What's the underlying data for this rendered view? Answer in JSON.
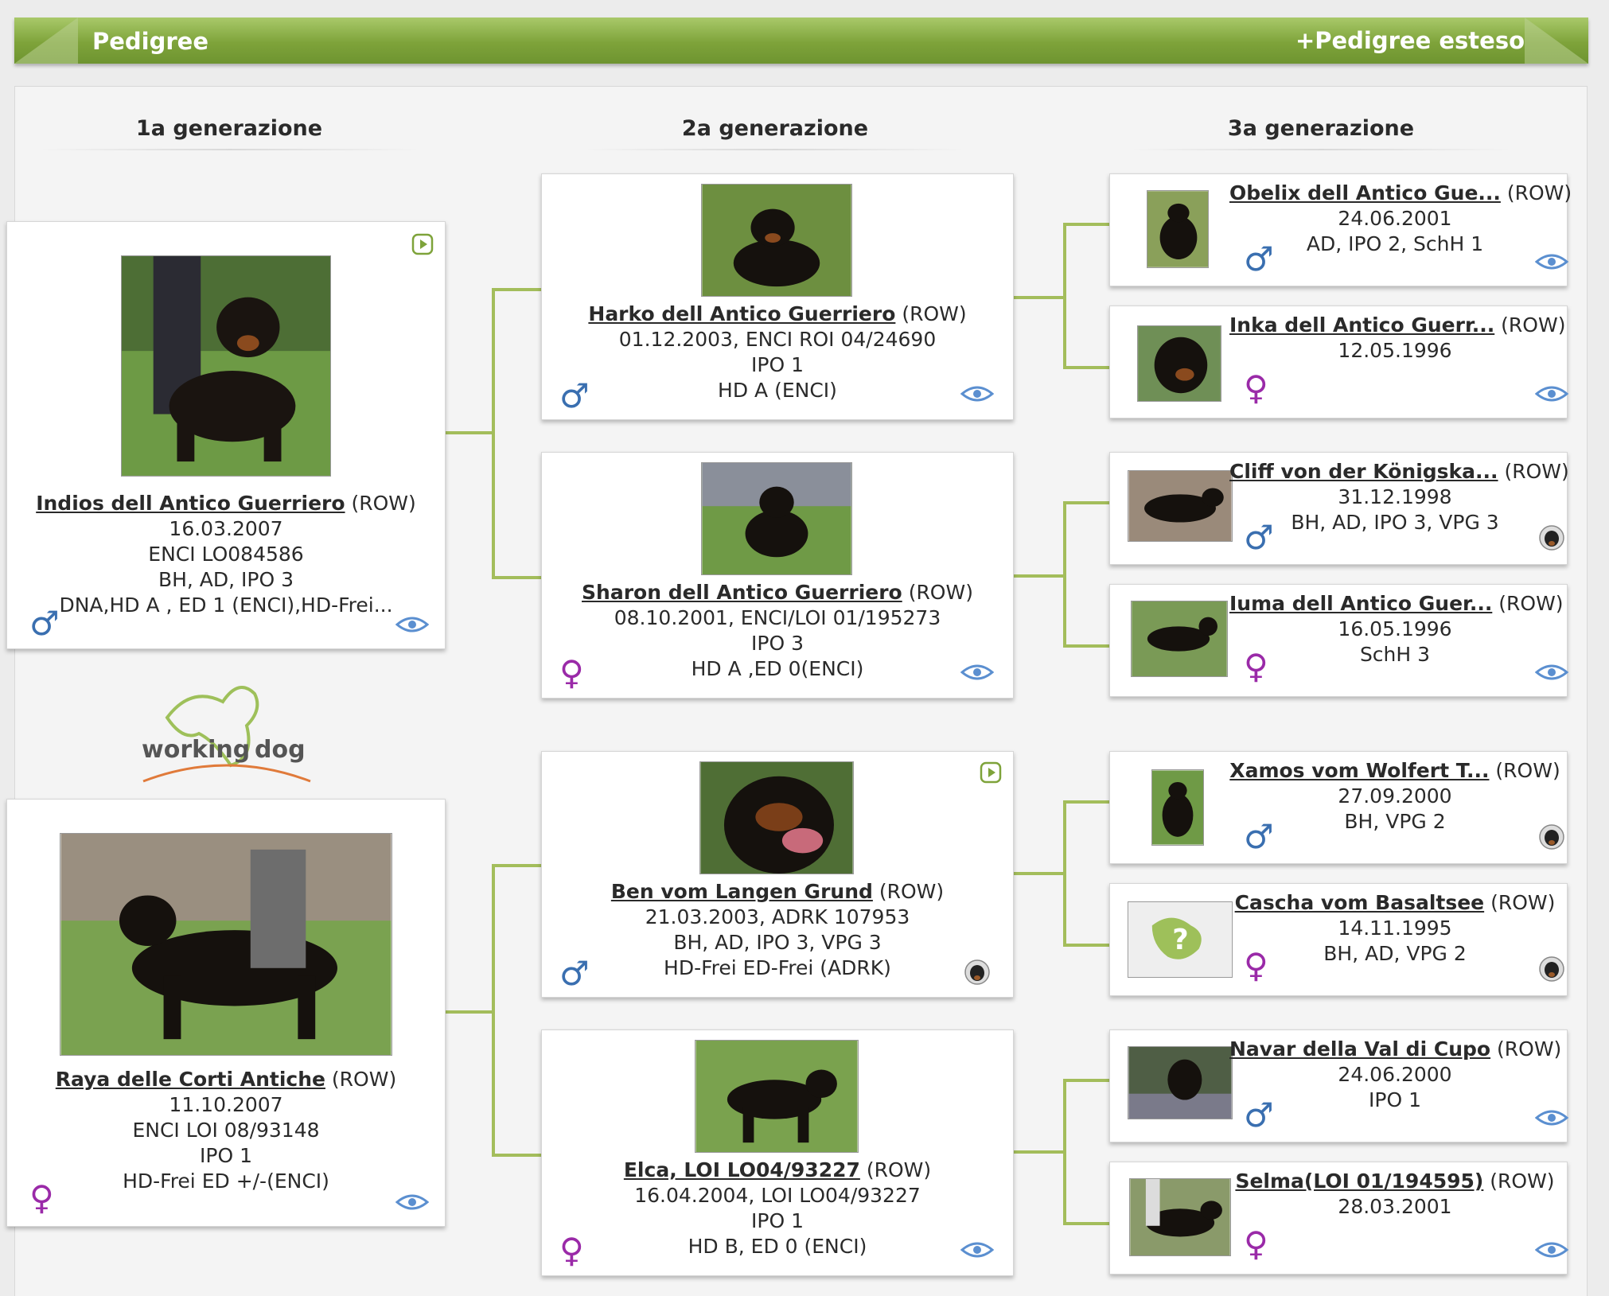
{
  "header": {
    "title": "Pedigree",
    "extended_link": "+Pedigree esteso"
  },
  "generations": [
    "1a generazione",
    "2a generazione",
    "3a generazione"
  ],
  "gen1": [
    {
      "name": "Indios dell Antico Guerriero",
      "breed": "(ROW)",
      "lines": [
        "16.03.2007",
        "ENCI LO084586",
        "BH, AD, IPO 3",
        "DNA,HD A , ED 1 (ENCI),HD-Frei..."
      ],
      "sex": "male",
      "badge": "eye-icon",
      "video": true
    },
    {
      "name": "Raya delle Corti Antiche",
      "breed": "(ROW)",
      "lines": [
        "11.10.2007",
        "ENCI LOI 08/93148",
        "IPO 1",
        "HD-Frei ED +/-(ENCI)"
      ],
      "sex": "female",
      "badge": "eye-icon",
      "video": false
    }
  ],
  "gen2": [
    {
      "name": "Harko dell Antico Guerriero",
      "breed": "(ROW)",
      "lines": [
        "01.12.2003, ENCI ROI 04/24690",
        "IPO 1",
        "HD A (ENCI)"
      ],
      "sex": "male",
      "badge": "eye-icon",
      "video": false
    },
    {
      "name": "Sharon dell Antico Guerriero",
      "breed": "(ROW)",
      "lines": [
        "08.10.2001, ENCI/LOI 01/195273",
        "IPO 3",
        "HD A ,ED 0(ENCI)"
      ],
      "sex": "female",
      "badge": "eye-icon",
      "video": false
    },
    {
      "name": "Ben vom Langen Grund",
      "breed": "(ROW)",
      "lines": [
        "21.03.2003, ADRK 107953",
        "BH, AD, IPO 3, VPG 3",
        "HD-Frei ED-Frei (ADRK)"
      ],
      "sex": "male",
      "badge": "rottweiler-icon",
      "video": true
    },
    {
      "name": "Elca, LOI LO04/93227",
      "breed": "(ROW)",
      "lines": [
        "16.04.2004, LOI LO04/93227",
        "IPO 1",
        "HD B, ED 0 (ENCI)"
      ],
      "sex": "female",
      "badge": "eye-icon",
      "video": false
    }
  ],
  "gen3": [
    {
      "name": "Obelix dell Antico Gue...",
      "breed": "(ROW)",
      "lines": [
        "24.06.2001",
        "AD, IPO 2, SchH 1"
      ],
      "sex": "male",
      "badge": "eye-icon"
    },
    {
      "name": "Inka dell Antico Guerr...",
      "breed": "(ROW)",
      "lines": [
        "12.05.1996"
      ],
      "sex": "female",
      "badge": "eye-icon"
    },
    {
      "name": "Cliff von der Königska...",
      "breed": "(ROW)",
      "lines": [
        "31.12.1998",
        "BH, AD, IPO 3, VPG 3"
      ],
      "sex": "male",
      "badge": "rottweiler-icon"
    },
    {
      "name": "Iuma dell Antico Guer...",
      "breed": "(ROW)",
      "lines": [
        "16.05.1996",
        "SchH 3"
      ],
      "sex": "female",
      "badge": "eye-icon"
    },
    {
      "name": "Xamos vom Wolfert T...",
      "breed": "(ROW)",
      "lines": [
        "27.09.2000",
        "BH, VPG 2"
      ],
      "sex": "male",
      "badge": "rottweiler-icon"
    },
    {
      "name": "Cascha vom Basaltsee",
      "breed": "(ROW)",
      "lines": [
        "14.11.1995",
        "BH, AD, VPG 2"
      ],
      "sex": "female",
      "badge": "rottweiler-icon",
      "no_photo": true
    },
    {
      "name": "Navar della Val di Cupo",
      "breed": "(ROW)",
      "lines": [
        "24.06.2000",
        "IPO 1"
      ],
      "sex": "male",
      "badge": "eye-icon"
    },
    {
      "name": "Selma(LOI 01/194595)",
      "breed": "(ROW)",
      "lines": [
        "28.03.2001"
      ],
      "sex": "female",
      "badge": "eye-icon"
    }
  ],
  "logo": {
    "text_left": "working",
    "text_right": "dog"
  },
  "symbols": {
    "male": "♂",
    "female": "♀"
  },
  "colors": {
    "accent_green": "#7ea33a",
    "connector": "#a3bd5b",
    "male": "#3a6fb0",
    "female": "#9a2aa8"
  }
}
